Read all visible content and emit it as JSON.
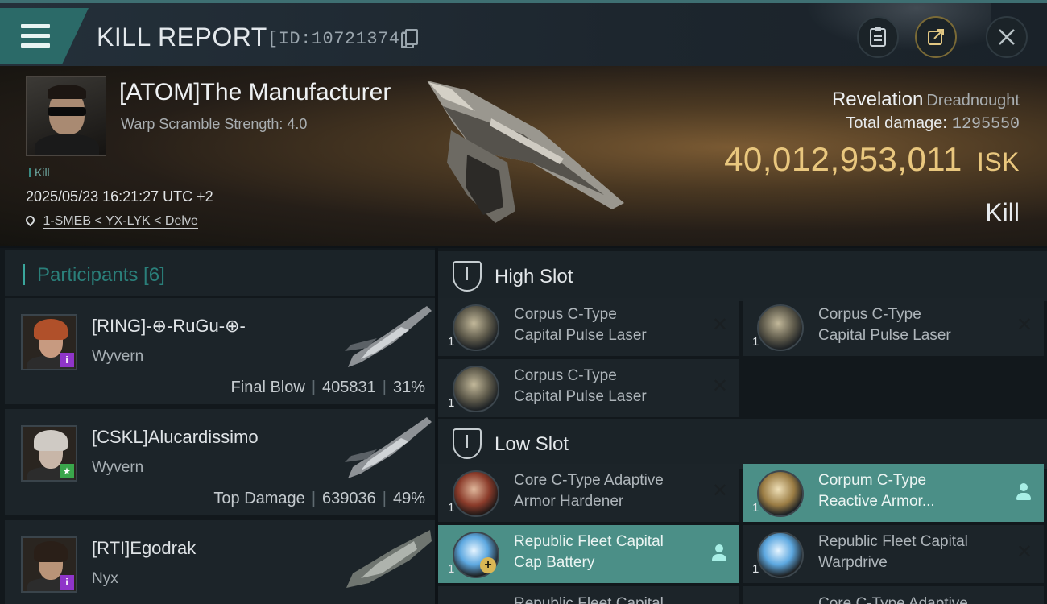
{
  "header": {
    "title": "KILL REPORT",
    "report_id": "[ID:10721374]",
    "buttons": {
      "notes": "notes-icon",
      "share": "share-icon",
      "close": "close-icon"
    }
  },
  "victim": {
    "name": "[ATOM]The Manufacturer",
    "warp_scramble": "Warp Scramble Strength: 4.0",
    "tag": "Kill",
    "datetime": "2025/05/23 16:21:27 UTC +2",
    "location": "1-SMEB < YX-LYK < Delve",
    "ship_name": "Revelation",
    "ship_class": "Dreadnought",
    "total_damage_label": "Total damage:",
    "total_damage": "1295550",
    "isk_value": "40,012,953,011",
    "isk_unit": "ISK",
    "result": "Kill"
  },
  "participants": {
    "title": "Participants [6]",
    "items": [
      {
        "name": "[RING]-⊕-RuGu-⊕-",
        "ship": "Wyvern",
        "role": "Final Blow",
        "damage": "405831",
        "percent": "31%"
      },
      {
        "name": "[CSKL]Alucardissimo",
        "ship": "Wyvern",
        "role": "Top Damage",
        "damage": "639036",
        "percent": "49%"
      },
      {
        "name": "[RTI]Egodrak",
        "ship": "Nyx"
      }
    ]
  },
  "fitting": {
    "high_slot": {
      "title": "High Slot",
      "modules": [
        {
          "line1": "Corpus C-Type",
          "line2": "Capital Pulse Laser",
          "qty": "1"
        },
        {
          "line1": "Corpus C-Type",
          "line2": "Capital Pulse Laser",
          "qty": "1"
        },
        {
          "line1": "Corpus C-Type",
          "line2": "Capital Pulse Laser",
          "qty": "1"
        }
      ]
    },
    "low_slot": {
      "title": "Low Slot",
      "modules": [
        {
          "line1": "Core C-Type Adaptive",
          "line2": "Armor Hardener",
          "qty": "1"
        },
        {
          "line1": "Corpum C-Type",
          "line2": "Reactive Armor...",
          "qty": "1"
        },
        {
          "line1": "Republic Fleet Capital",
          "line2": "Cap Battery",
          "qty": "1"
        },
        {
          "line1": "Republic Fleet Capital",
          "line2": "Warpdrive",
          "qty": "1"
        },
        {
          "line1": "Republic Fleet Capital",
          "qty": ""
        },
        {
          "line1": "Core C-Type Adaptive",
          "qty": ""
        }
      ]
    }
  },
  "colors": {
    "accent_teal": "#2b6a68",
    "isk_gold": "#e9c77e",
    "dropped_teal": "#4b8f87"
  }
}
